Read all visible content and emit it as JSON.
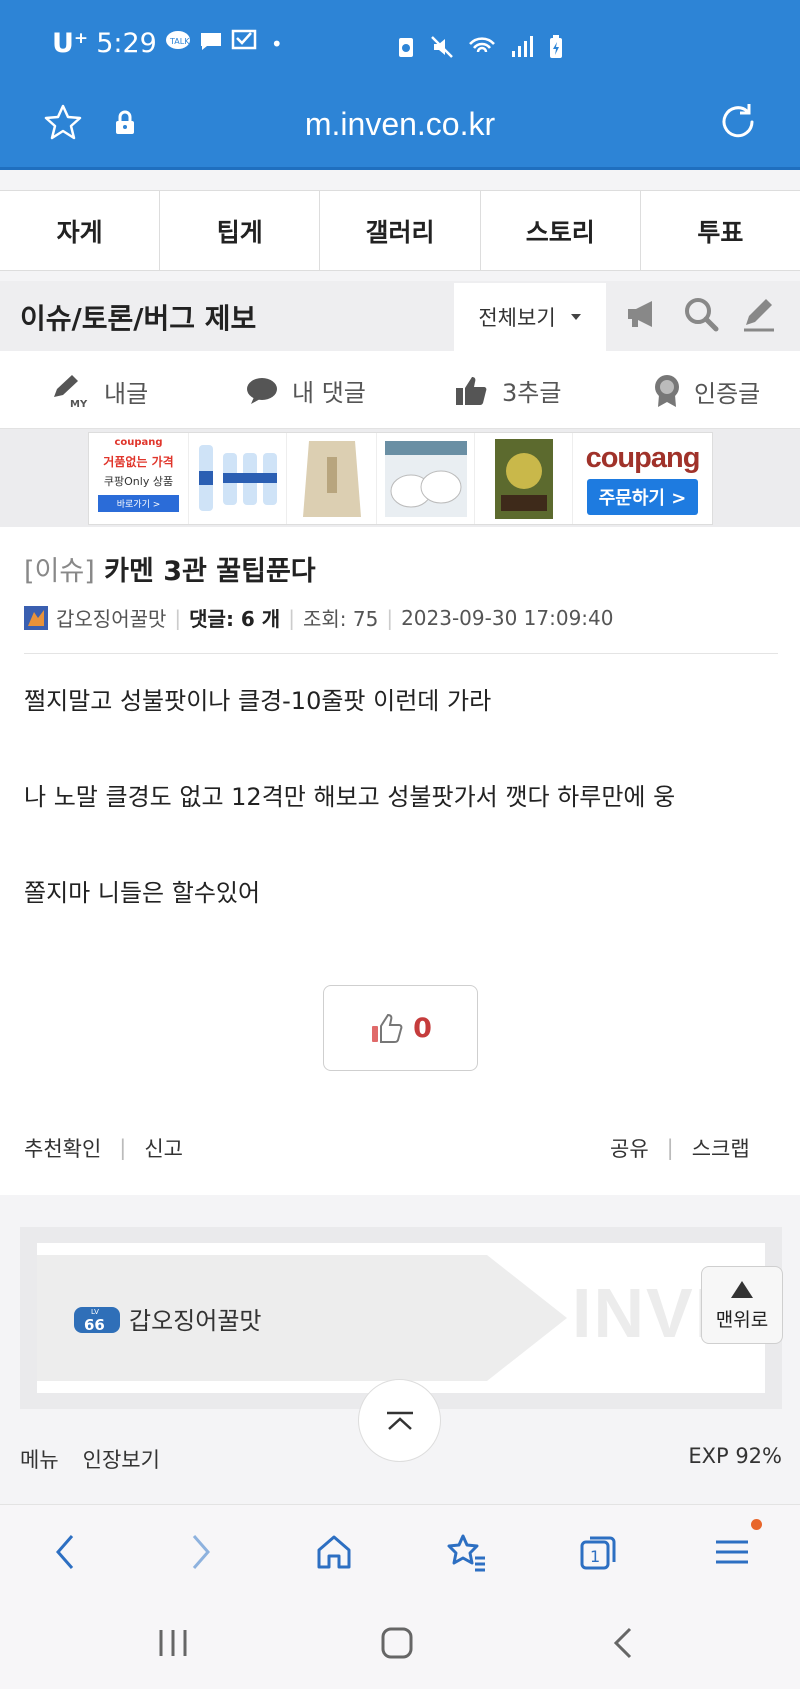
{
  "status_bar": {
    "carrier": "U⁺",
    "time": "5:29"
  },
  "url_bar": {
    "url": "m.inven.co.kr"
  },
  "tabs": [
    {
      "label": "자게"
    },
    {
      "label": "팁게"
    },
    {
      "label": "갤러리"
    },
    {
      "label": "스토리"
    },
    {
      "label": "투표"
    }
  ],
  "board": {
    "title": "이슈/토론/버그 제보",
    "view_select": "전체보기"
  },
  "filters": [
    {
      "label": "내글",
      "icon": "my-pen-icon"
    },
    {
      "label": "내 댓글",
      "icon": "comment-icon"
    },
    {
      "label": "3추글",
      "icon": "thumbs-up-icon"
    },
    {
      "label": "인증글",
      "icon": "badge-icon"
    }
  ],
  "ad": {
    "headline": "거품없는 가격",
    "sub": "쿠팡Only 상품",
    "cta_small": "바로가기 >",
    "brand": "coupang",
    "order_button": "주문하기 >"
  },
  "article": {
    "tag": "[이슈]",
    "title": "카멘 3관 꿀팁푼다",
    "author": "갑오징어꿀맛",
    "comments_label": "댓글: 6 개",
    "views": "조회: 75",
    "datetime": "2023-09-30 17:09:40",
    "body": [
      "쩔지말고 성불팟이나 클경-10줄팟 이런데 가라",
      "나 노말 클경도 없고 12격만 해보고 성불팟가서 깻다 하루만에 웅",
      "쫄지마 니들은 할수있어"
    ],
    "like_count": "0",
    "actions_left": [
      "추천확인",
      "신고"
    ],
    "actions_right": [
      "공유",
      "스크랩"
    ]
  },
  "profile_card": {
    "level": "66",
    "level_prefix": "LV",
    "name": "갑오징어꿀맛",
    "watermark": "INVEN"
  },
  "top_button": {
    "label": "맨위로"
  },
  "footer": {
    "menu": "메뉴",
    "stamp": "인장보기",
    "exp": "EXP 92%"
  },
  "colors": {
    "brand_blue": "#2d84d6",
    "like_red": "#c53c3c",
    "notify_dot": "#e8662b"
  }
}
